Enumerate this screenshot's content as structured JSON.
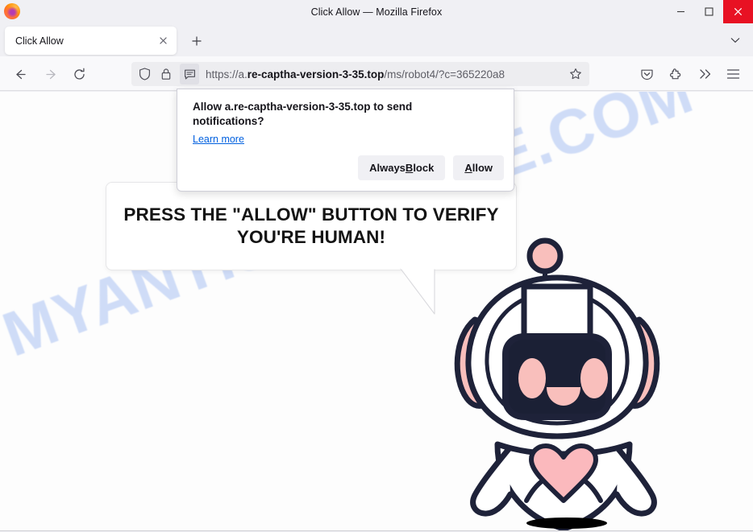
{
  "window": {
    "title": "Click Allow — Mozilla Firefox",
    "logo_icon": "firefox-logo",
    "controls": {
      "minimize": "minimize-icon",
      "maximize": "maximize-icon",
      "close": "close-icon"
    },
    "close_color": "#e81123"
  },
  "tabs": {
    "active": {
      "label": "Click Allow",
      "close_icon": "close-icon"
    },
    "new_tab_icon": "plus-icon",
    "list_all_icon": "chevron-down-icon"
  },
  "nav": {
    "back_icon": "arrow-left-icon",
    "forward_icon": "arrow-right-icon",
    "reload_icon": "reload-icon",
    "shield_icon": "shield-icon",
    "lock_icon": "lock-icon",
    "notification_icon": "notification-bubble-icon",
    "bookmark_icon": "star-icon",
    "pocket_icon": "pocket-icon",
    "extensions_icon": "puzzle-piece-icon",
    "overflow_icon": "double-chevron-right-icon",
    "menu_icon": "hamburger-menu-icon",
    "url": {
      "scheme": "https://a.",
      "domain": "re-captha-version-3-35.top",
      "path": "/ms/robot4/?c=365220a8"
    }
  },
  "permission_popup": {
    "title": "Allow a.re-captha-version-3-35.top to send notifications?",
    "learn_more": "Learn more",
    "buttons": {
      "always_block": {
        "prefix": "Always ",
        "accel": "B",
        "suffix": "lock"
      },
      "allow": {
        "accel": "A",
        "suffix": "llow"
      }
    }
  },
  "page": {
    "bubble_text": "PRESS THE \"ALLOW\" BUTTON TO VERIFY YOU'RE HUMAN!",
    "watermark": "MYANTISPYWARE.COM",
    "watermark_color": "#cfdcf7",
    "robot_icon": "robot-mascot-illustration",
    "robot_colors": {
      "outline": "#1e2239",
      "accent": "#f9bfbc",
      "screen": "#1b2035",
      "body": "#ffffff",
      "heart": "#fbb9bd"
    }
  }
}
